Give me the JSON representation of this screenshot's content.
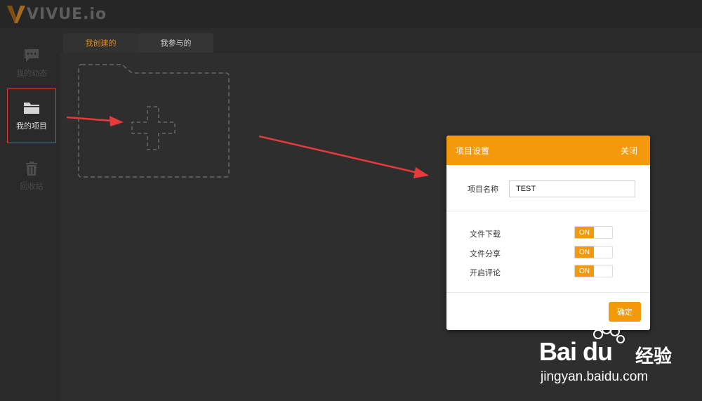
{
  "app": {
    "logo_text": "VIVUE.io"
  },
  "sidebar": {
    "items": [
      {
        "label": "我的动态",
        "icon": "chat-bubble-icon",
        "active": false
      },
      {
        "label": "我的项目",
        "icon": "folder-icon",
        "active": true
      },
      {
        "label": "回收站",
        "icon": "trash-icon",
        "active": false
      }
    ]
  },
  "tabs": [
    {
      "label": "我创建的",
      "active": true
    },
    {
      "label": "我参与的",
      "active": false
    }
  ],
  "new_project": {
    "icon": "add-folder-icon"
  },
  "dialog": {
    "title": "项目设置",
    "close_label": "关闭",
    "name_label": "项目名称",
    "name_value": "TEST",
    "toggles": [
      {
        "label": "文件下载",
        "state": "ON"
      },
      {
        "label": "文件分享",
        "state": "ON"
      },
      {
        "label": "开启评论",
        "state": "ON"
      }
    ],
    "confirm_label": "确定"
  },
  "watermark": {
    "brand": "Bai du",
    "brand_cn": "经验",
    "url": "jingyan.baidu.com"
  },
  "colors": {
    "accent": "#f5990c",
    "highlight_border": "#e03b3b",
    "arrow": "#e83a3a",
    "background": "#2e2e2e"
  }
}
